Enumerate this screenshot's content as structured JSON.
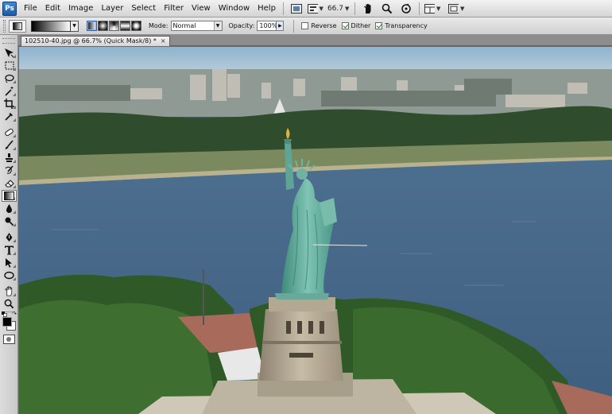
{
  "app": {
    "logo": "Ps"
  },
  "menubar": {
    "items": [
      "File",
      "Edit",
      "Image",
      "Layer",
      "Select",
      "Filter",
      "View",
      "Window",
      "Help"
    ],
    "zoom_value": "66.7"
  },
  "options": {
    "mode_label": "Mode:",
    "mode_value": "Normal",
    "opacity_label": "Opacity:",
    "opacity_value": "100%",
    "reverse_label": "Reverse",
    "reverse_checked": false,
    "dither_label": "Dither",
    "dither_checked": true,
    "transparency_label": "Transparency",
    "transparency_checked": true,
    "gradient_types": [
      "linear",
      "radial",
      "angle",
      "reflected",
      "diamond"
    ]
  },
  "document": {
    "tab_title": "102510-40.jpg @ 66.7% (Quick Mask/8) *",
    "close_glyph": "×"
  },
  "toolbox": {
    "tools": [
      "move-tool",
      "marquee-tool",
      "lasso-tool",
      "quick-select-tool",
      "crop-tool",
      "eyedropper-tool",
      "healing-tool",
      "brush-tool",
      "clone-stamp-tool",
      "history-brush-tool",
      "eraser-tool",
      "gradient-tool",
      "blur-tool",
      "dodge-tool",
      "pen-tool",
      "type-tool",
      "path-select-tool",
      "shape-tool",
      "hand-tool",
      "zoom-tool"
    ],
    "active_tool": "gradient-tool",
    "foreground_color": "#000000",
    "background_color": "#ffffff"
  }
}
